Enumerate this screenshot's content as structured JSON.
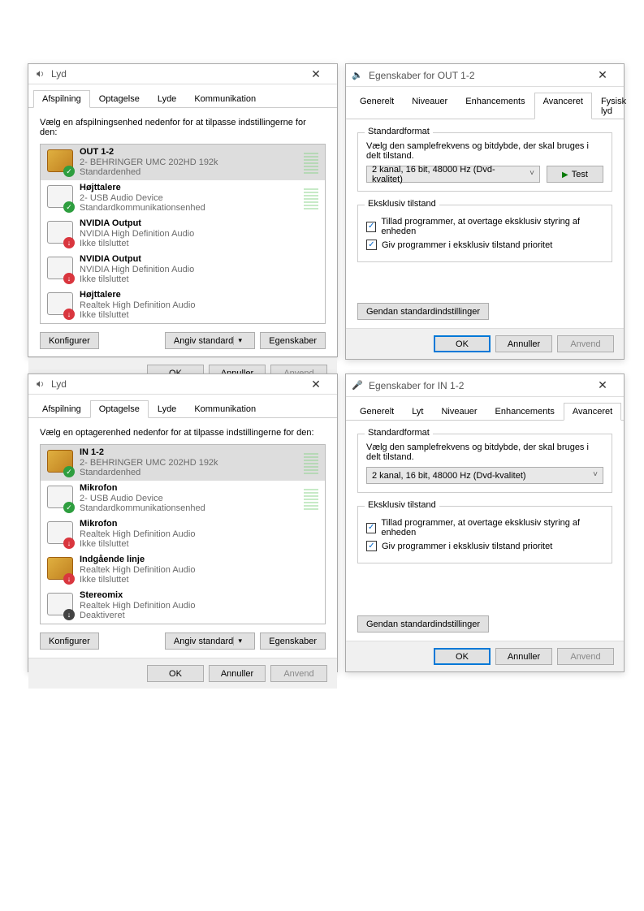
{
  "soundDialog1": {
    "title": "Lyd",
    "tabs": [
      "Afspilning",
      "Optagelse",
      "Lyde",
      "Kommunikation"
    ],
    "activeTab": 0,
    "intro": "Vælg en afspilningsenhed nedenfor for at tilpasse indstillingerne for den:",
    "devices": [
      {
        "name": "OUT 1-2",
        "sub": "2- BEHRINGER UMC 202HD 192k",
        "status": "Standardenhed",
        "badge": "ok",
        "selected": true,
        "meter": true,
        "iconType": "jack"
      },
      {
        "name": "Højttalere",
        "sub": "2- USB Audio Device",
        "status": "Standardkommunikationsenhed",
        "badge": "ok",
        "selected": false,
        "meter": true,
        "iconType": "speaker"
      },
      {
        "name": "NVIDIA Output",
        "sub": "NVIDIA High Definition Audio",
        "status": "Ikke tilsluttet",
        "badge": "err",
        "selected": false,
        "meter": false,
        "iconType": "monitor"
      },
      {
        "name": "NVIDIA Output",
        "sub": "NVIDIA High Definition Audio",
        "status": "Ikke tilsluttet",
        "badge": "err",
        "selected": false,
        "meter": false,
        "iconType": "monitor"
      },
      {
        "name": "Højttalere",
        "sub": "Realtek High Definition Audio",
        "status": "Ikke tilsluttet",
        "badge": "err",
        "selected": false,
        "meter": false,
        "iconType": "speaker"
      }
    ],
    "configure": "Konfigurer",
    "setDefault": "Angiv standard",
    "properties": "Egenskaber",
    "ok": "OK",
    "cancel": "Annuller",
    "apply": "Anvend"
  },
  "propDialog1": {
    "title": "Egenskaber for OUT 1-2",
    "tabs": [
      "Generelt",
      "Niveauer",
      "Enhancements",
      "Avanceret",
      "Fysisk lyd"
    ],
    "activeTab": 3,
    "group1": {
      "legend": "Standardformat",
      "text": "Vælg den samplefrekvens og bitdybde, der skal bruges i delt tilstand.",
      "combo": "2 kanal, 16 bit, 48000 Hz (Dvd-kvalitet)",
      "test": "Test"
    },
    "group2": {
      "legend": "Eksklusiv tilstand",
      "chk1": "Tillad programmer, at overtage eksklusiv styring af enheden",
      "chk2": "Giv programmer i eksklusiv tilstand prioritet"
    },
    "restore": "Gendan standardindstillinger",
    "ok": "OK",
    "cancel": "Annuller",
    "apply": "Anvend"
  },
  "soundDialog2": {
    "title": "Lyd",
    "tabs": [
      "Afspilning",
      "Optagelse",
      "Lyde",
      "Kommunikation"
    ],
    "activeTab": 1,
    "intro": "Vælg en optagerenhed nedenfor for at tilpasse indstillingerne for den:",
    "devices": [
      {
        "name": "IN 1-2",
        "sub": "2- BEHRINGER UMC 202HD 192k",
        "status": "Standardenhed",
        "badge": "ok",
        "selected": true,
        "meter": true,
        "iconType": "jack"
      },
      {
        "name": "Mikrofon",
        "sub": "2- USB Audio Device",
        "status": "Standardkommunikationsenhed",
        "badge": "ok",
        "selected": false,
        "meter": true,
        "iconType": "mic"
      },
      {
        "name": "Mikrofon",
        "sub": "Realtek High Definition Audio",
        "status": "Ikke tilsluttet",
        "badge": "err",
        "selected": false,
        "meter": false,
        "iconType": "mic"
      },
      {
        "name": "Indgående linje",
        "sub": "Realtek High Definition Audio",
        "status": "Ikke tilsluttet",
        "badge": "err",
        "selected": false,
        "meter": false,
        "iconType": "jack"
      },
      {
        "name": "Stereomix",
        "sub": "Realtek High Definition Audio",
        "status": "Deaktiveret",
        "badge": "off",
        "selected": false,
        "meter": false,
        "iconType": "chip"
      }
    ],
    "configure": "Konfigurer",
    "setDefault": "Angiv standard",
    "properties": "Egenskaber",
    "ok": "OK",
    "cancel": "Annuller",
    "apply": "Anvend"
  },
  "propDialog2": {
    "title": "Egenskaber for IN 1-2",
    "tabs": [
      "Generelt",
      "Lyt",
      "Niveauer",
      "Enhancements",
      "Avanceret"
    ],
    "activeTab": 4,
    "group1": {
      "legend": "Standardformat",
      "text": "Vælg den samplefrekvens og bitdybde, der skal bruges i delt tilstand.",
      "combo": "2 kanal, 16 bit, 48000 Hz (Dvd-kvalitet)"
    },
    "group2": {
      "legend": "Eksklusiv tilstand",
      "chk1": "Tillad programmer, at overtage eksklusiv styring af enheden",
      "chk2": "Giv programmer i eksklusiv tilstand prioritet"
    },
    "restore": "Gendan standardindstillinger",
    "ok": "OK",
    "cancel": "Annuller",
    "apply": "Anvend"
  }
}
